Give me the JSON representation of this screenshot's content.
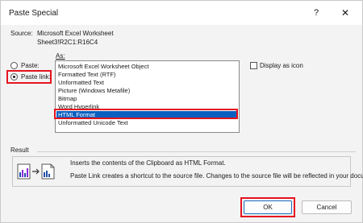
{
  "window": {
    "title": "Paste Special",
    "help_glyph": "?",
    "close_glyph": "✕"
  },
  "source": {
    "label": "Source:",
    "value": "Microsoft Excel Worksheet",
    "range": "Sheet3!R2C1:R16C4"
  },
  "as_label": "As:",
  "paste_options": {
    "paste_label": "Paste:",
    "paste_link_label": "Paste link:",
    "selected": "paste_link"
  },
  "formats": [
    "Microsoft Excel Worksheet Object",
    "Formatted Text (RTF)",
    "Unformatted Text",
    "Picture (Windows Metafile)",
    "Bitmap",
    "Word Hyperlink",
    "HTML Format",
    "Unformatted Unicode Text"
  ],
  "selected_format": "HTML Format",
  "display_as_icon": {
    "label": "Display as icon",
    "checked": false
  },
  "result": {
    "label": "Result",
    "line1": "Inserts the contents of the Clipboard as HTML Format.",
    "line2": "Paste Link creates a shortcut to the source file. Changes to the source file will be reflected in your document."
  },
  "buttons": {
    "ok": "OK",
    "cancel": "Cancel"
  },
  "colors": {
    "highlight": "#e5131f",
    "selection": "#0a5fc0"
  },
  "icons": {
    "help": "question-mark-icon",
    "close": "close-icon",
    "result": "paste-link-document-icon"
  }
}
